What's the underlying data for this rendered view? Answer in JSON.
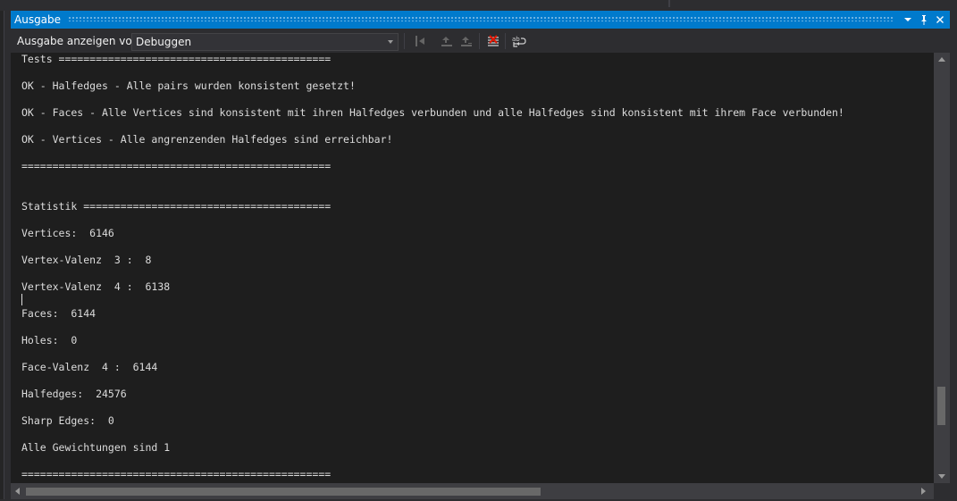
{
  "panel": {
    "title": "Ausgabe",
    "controls": {
      "dropdown_icon": "dropdown-arrow-icon",
      "pin_icon": "pin-icon",
      "close_icon": "close-icon"
    }
  },
  "toolbar": {
    "show_output_label": "Ausgabe anzeigen von:",
    "source_select_value": "Debuggen",
    "buttons": [
      {
        "name": "go-to-previous-message-icon"
      },
      {
        "name": "go-to-next-message-icon"
      },
      {
        "name": "go-to-last-message-icon"
      },
      {
        "name": "clear-all-icon"
      },
      {
        "name": "toggle-word-wrap-icon"
      }
    ]
  },
  "output": {
    "text": "Tests ============================================\n\nOK - Halfedges - Alle pairs wurden konsistent gesetzt!\n\nOK - Faces - Alle Vertices sind konsistent mit ihren Halfedges verbunden und alle Halfedges sind konsistent mit ihrem Face verbunden!\n\nOK - Vertices - Alle angrenzenden Halfedges sind erreichbar!\n\n==================================================\n\n\nStatistik ========================================\n\nVertices:  6146\n\nVertex-Valenz  3 :  8\n\nVertex-Valenz  4 :  6138\n\nFaces:  6144\n\nHoles:  0\n\nFace-Valenz  4 :  6144\n\nHalfedges:  24576\n\nSharp Edges:  0\n\nAlle Gewichtungen sind 1\n\n=================================================="
  },
  "colors": {
    "accent": "#007acc",
    "background": "#1e1e1e",
    "chrome": "#2d2d30",
    "text": "#dcdcdc"
  }
}
